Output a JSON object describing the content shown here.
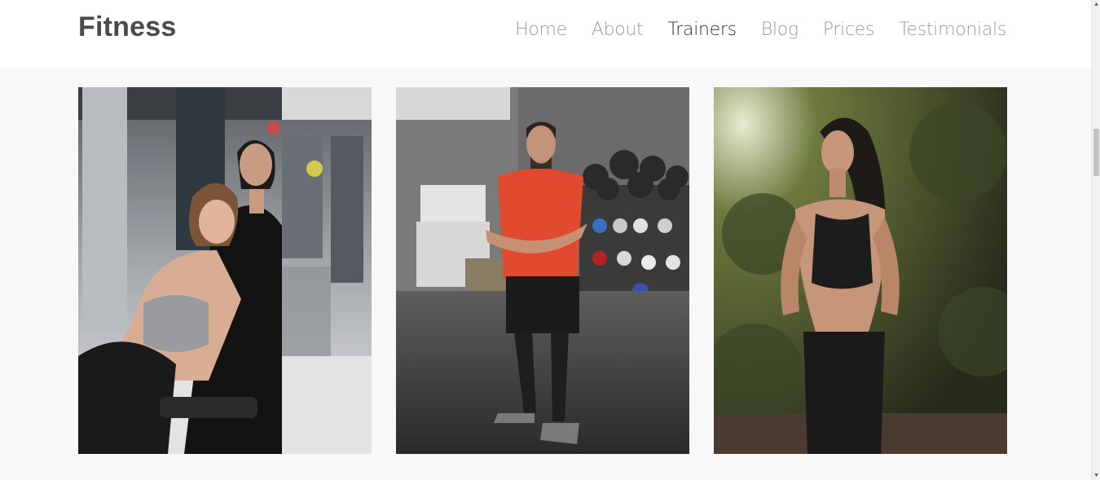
{
  "header": {
    "brand": "Fitness",
    "nav": [
      {
        "label": "Home",
        "active": false
      },
      {
        "label": "About",
        "active": false
      },
      {
        "label": "Trainers",
        "active": true
      },
      {
        "label": "Blog",
        "active": false
      },
      {
        "label": "Prices",
        "active": false
      },
      {
        "label": "Testimonials",
        "active": false
      }
    ]
  },
  "trainers": [
    {
      "photo": "trainer-couple-gym-photo"
    },
    {
      "photo": "trainer-man-red-shirt-photo"
    },
    {
      "photo": "trainer-woman-outdoor-photo"
    }
  ],
  "colors": {
    "page_bg": "#f8f8f8",
    "header_bg": "#ffffff",
    "brand_text": "#4a4a4a",
    "nav_text": "#9a9a9a",
    "nav_active": "#333333"
  }
}
